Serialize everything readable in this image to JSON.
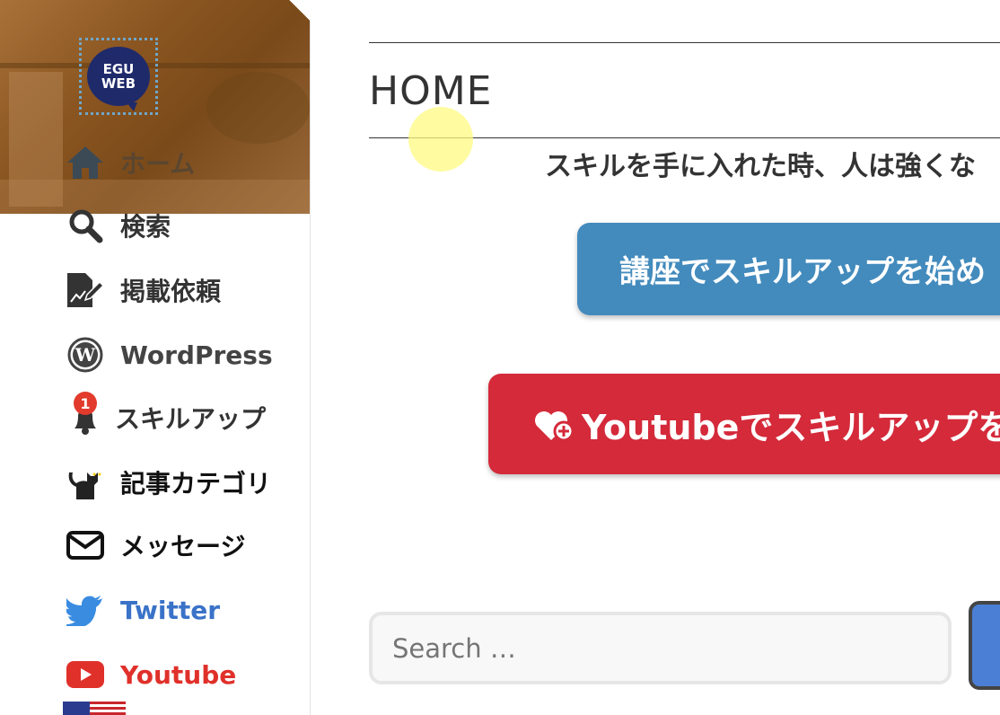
{
  "sidebar": {
    "logo": {
      "line1": "EGU",
      "line2": "WEB"
    },
    "items": [
      {
        "label": "ホーム",
        "icon": "home-icon"
      },
      {
        "label": "検索",
        "icon": "search-icon"
      },
      {
        "label": "掲載依頼",
        "icon": "document-edit-icon"
      },
      {
        "label": "WordPress",
        "icon": "wordpress-icon"
      },
      {
        "label": "スキルアップ",
        "icon": "bell-icon",
        "badge": "1"
      },
      {
        "label": "記事カテゴリ",
        "icon": "cat-icon"
      },
      {
        "label": "メッセージ",
        "icon": "envelope-icon"
      },
      {
        "label": "Twitter",
        "icon": "twitter-icon"
      },
      {
        "label": "Youtube",
        "icon": "youtube-icon"
      }
    ],
    "flag_icon": "us-flag-icon"
  },
  "main": {
    "title": "HOME",
    "tagline": "スキルを手に入れた時、人は強くな",
    "cta_primary": "講座でスキルアップを始め",
    "cta_secondary": "Youtubeでスキルアップを"
  },
  "search": {
    "placeholder": "Search …"
  },
  "colors": {
    "cta_blue": "#438bbd",
    "cta_red": "#d42a3a",
    "twitter": "#3a72c8",
    "youtube": "#e0302a",
    "logo_navy": "#1f2a6b"
  }
}
